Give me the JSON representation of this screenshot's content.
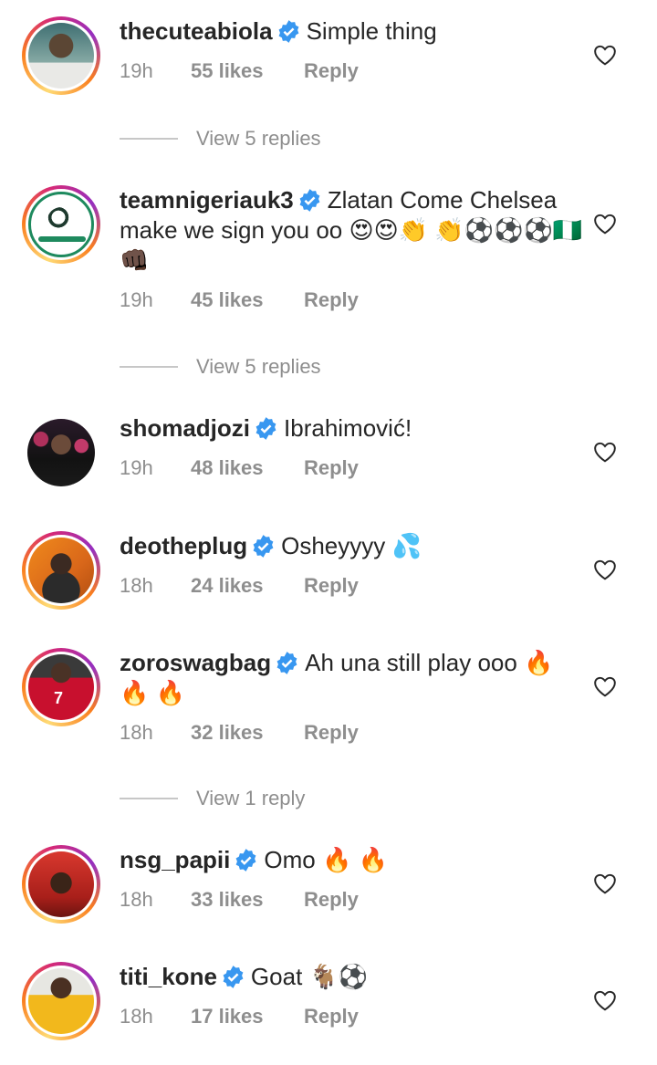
{
  "comments": [
    {
      "username": "thecuteabiola",
      "text": "Simple thing",
      "time": "19h",
      "likes": "55 likes",
      "reply": "Reply",
      "avatar": "person-white-tee",
      "emojis": []
    },
    {
      "username": "teamnigeriauk3",
      "text": "Zlatan Come Chelsea make we sign you oo",
      "time": "19h",
      "likes": "45 likes",
      "reply": "Reply",
      "avatar": "team-nigeria-logo",
      "emojis": [
        "😍",
        "😍",
        "👏",
        "👏",
        "⚽",
        "⚽",
        "⚽",
        "🇳🇬",
        "👊🏿"
      ]
    },
    {
      "username": "shomadjozi",
      "text": "Ibrahimović!",
      "time": "19h",
      "likes": "48 likes",
      "reply": "Reply",
      "avatar": "person-dark-backdrop",
      "emojis": []
    },
    {
      "username": "deotheplug",
      "text": "Osheyyyy",
      "time": "18h",
      "likes": "24 likes",
      "reply": "Reply",
      "avatar": "person-orange",
      "emojis": [
        "💦"
      ]
    },
    {
      "username": "zoroswagbag",
      "text": "Ah una still play ooo",
      "time": "18h",
      "likes": "32 likes",
      "reply": "Reply",
      "avatar": "person-red-jersey",
      "emojis": [
        "🔥",
        "🔥",
        "🔥"
      ]
    },
    {
      "username": "nsg_papii",
      "text": "Omo",
      "time": "18h",
      "likes": "33 likes",
      "reply": "Reply",
      "avatar": "person-red-room",
      "emojis": [
        "🔥",
        "🔥"
      ]
    },
    {
      "username": "titi_kone",
      "text": "Goat",
      "time": "18h",
      "likes": "17 likes",
      "reply": "Reply",
      "avatar": "person-yellow-jersey",
      "emojis": [
        "🐐",
        "⚽"
      ]
    }
  ],
  "view_replies": [
    "View 5 replies",
    "View 5 replies",
    "View 1 reply"
  ],
  "colors": {
    "verified": "#3897f0",
    "muted": "#8e8e8e",
    "text": "#262626"
  }
}
